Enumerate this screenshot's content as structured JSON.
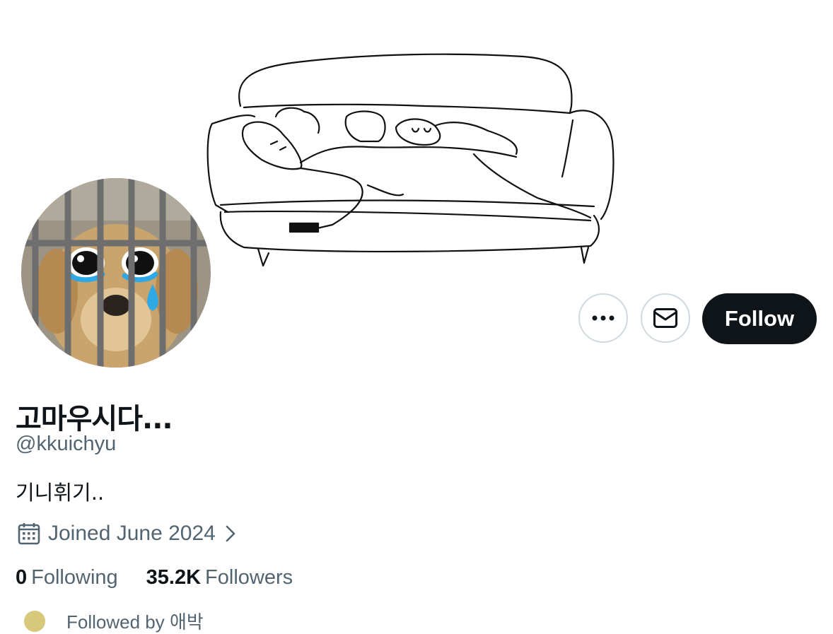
{
  "profile": {
    "display_name": "고마우시다...",
    "handle": "@kkuichyu",
    "bio": "기니휘기..",
    "joined": "Joined June 2024",
    "following_count": "0",
    "following_label": "Following",
    "followers_count": "35.2K",
    "followers_label": "Followers",
    "followed_by_text": "Followed by 애박"
  },
  "actions": {
    "follow_label": "Follow",
    "more_icon": "more-dots-icon",
    "message_icon": "envelope-icon"
  },
  "colors": {
    "primary_text": "#0f1419",
    "secondary_text": "#536471",
    "button_border": "#cfd9de",
    "follow_bg": "#0f1419",
    "tear_blue": "#1d9bf0"
  }
}
